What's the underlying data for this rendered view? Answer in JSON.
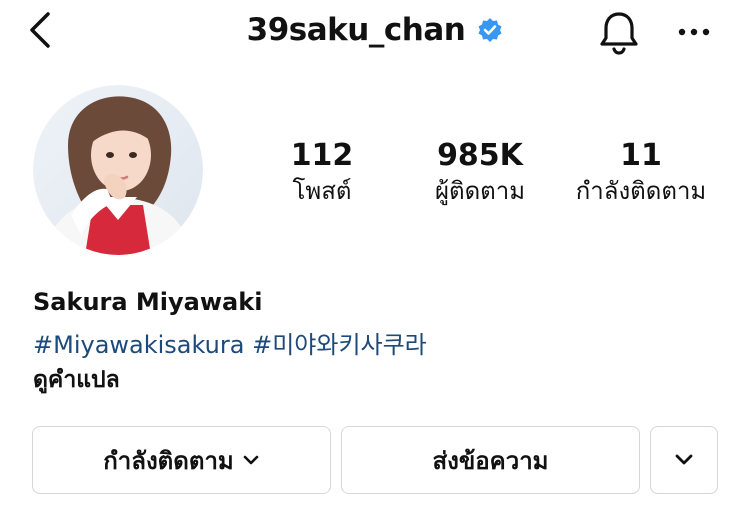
{
  "header": {
    "username": "39saku_chan",
    "verified": true,
    "icons": {
      "back": "back-chevron-icon",
      "verified": "verified-badge-icon",
      "bell": "bell-icon",
      "more": "more-horizontal-icon"
    }
  },
  "profile": {
    "avatar": "profile-photo"
  },
  "stats": {
    "posts": {
      "value": "112",
      "label": "โพสต์"
    },
    "followers": {
      "value": "985K",
      "label": "ผู้ติดตาม"
    },
    "following": {
      "value": "11",
      "label": "กำลังติดตาม"
    }
  },
  "bio": {
    "name": "Sakura Miyawaki",
    "hashtags": [
      "#Miyawakisakura",
      "#미야와키사쿠라"
    ],
    "translate": "ดูคำแปล"
  },
  "actions": {
    "following_button": "กำลังติดตาม",
    "message_button": "ส่งข้อความ",
    "suggest_icon": "chevron-down-icon"
  },
  "colors": {
    "hashtag": "#1d4a7a",
    "verified": "#3897f0",
    "border": "#d6d6d6"
  }
}
